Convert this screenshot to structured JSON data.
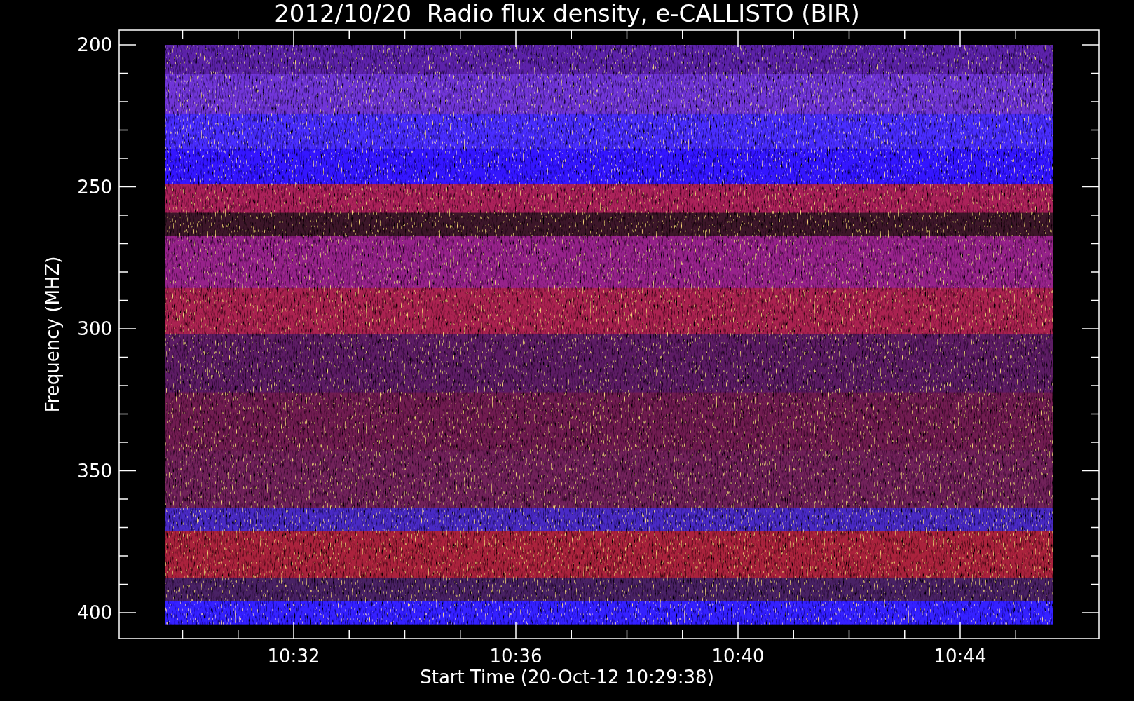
{
  "chart": {
    "title": "2012/10/20  Radio flux density, e-CALLISTO (BIR)",
    "ylabel": "Frequency (MHZ)",
    "xlabel": "Start Time (20-Oct-12 10:29:38)",
    "yticks": [
      "200",
      "250",
      "300",
      "350",
      "400"
    ],
    "xticks": [
      "10:32",
      "10:36",
      "10:40",
      "10:44"
    ]
  }
}
